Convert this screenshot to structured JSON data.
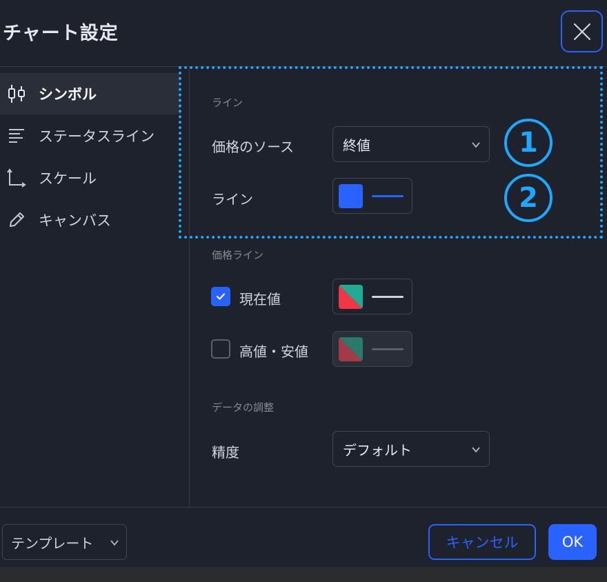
{
  "window": {
    "title": "チャート設定",
    "close_icon": "close-icon",
    "accent_color": "#2962ff",
    "annotation_color": "#1ea7fd"
  },
  "sidebar": {
    "items": [
      {
        "label": "シンボル",
        "icon": "candlestick-icon",
        "active": true
      },
      {
        "label": "ステータスライン",
        "icon": "status-lines-icon",
        "active": false
      },
      {
        "label": "スケール",
        "icon": "scale-axes-icon",
        "active": false
      },
      {
        "label": "キャンバス",
        "icon": "pencil-icon",
        "active": false
      }
    ]
  },
  "symbol": {
    "line_section": {
      "heading": "ライン",
      "price_source_label": "価格のソース",
      "price_source_value": "終値",
      "line_label": "ライン",
      "line_color": "#2962ff"
    },
    "price_line_section": {
      "heading": "価格ライン",
      "current_value": {
        "label": "現在値",
        "checked": true,
        "colors": [
          "#f23645",
          "#22ab94"
        ]
      },
      "high_low": {
        "label": "高値・安値",
        "checked": false,
        "colors": [
          "#a33a47",
          "#2a7a6b"
        ]
      }
    },
    "data_section": {
      "heading": "データの調整",
      "precision_label": "精度",
      "precision_value": "デフォルト"
    }
  },
  "annotations": {
    "callout_1": "1",
    "callout_2": "2"
  },
  "footer": {
    "template_label": "テンプレート",
    "cancel_label": "キャンセル",
    "ok_label": "OK"
  }
}
